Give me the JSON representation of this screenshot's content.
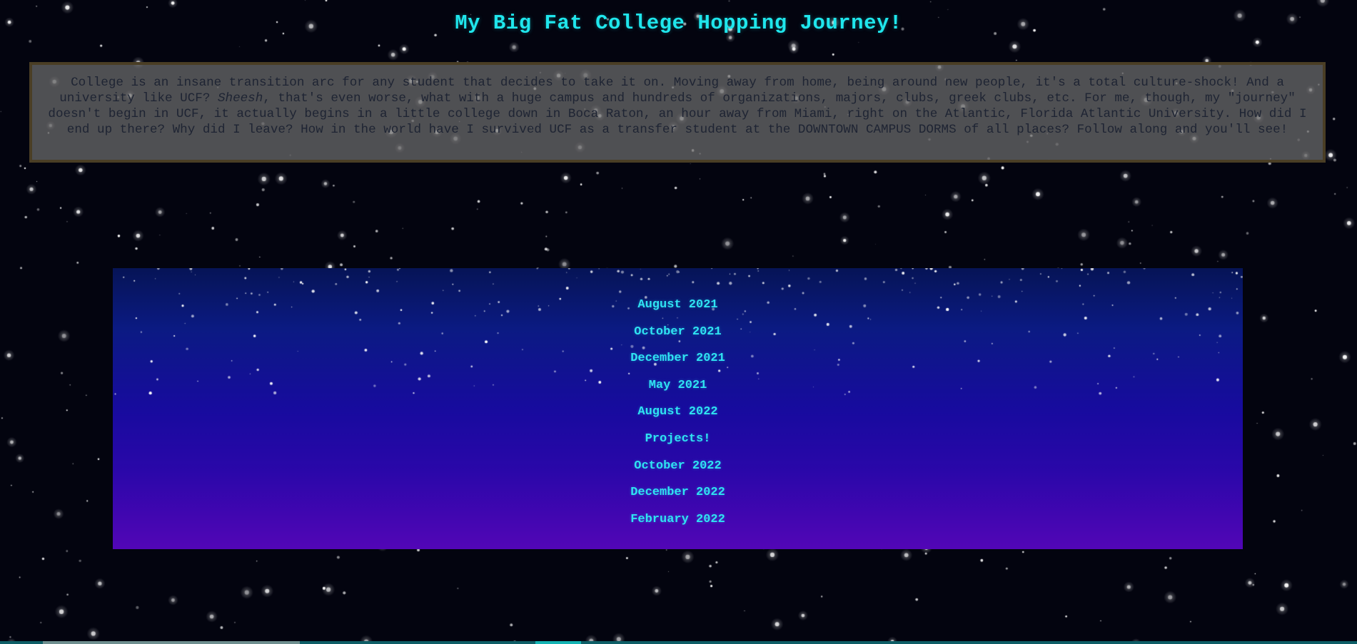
{
  "header": {
    "title": "My Big Fat College Hopping Journey!"
  },
  "intro": {
    "before_em": "College is an insane transition arc for any student that decides to take it on. Moving away from home, being around new people, it's a total culture-shock! And a university like UCF? ",
    "em": "Sheesh",
    "after_em": ", that's even worse, what with a huge campus and hundreds of organizations, majors, clubs, greek clubs, etc. For me, though, my \"journey\" doesn't begin in UCF, it actually begins in a little college down in Boca Raton, an hour away from Miami, right on the Atlantic, Florida Atlantic University. How did I end up there? Why did I leave? How in the world have I survived UCF as a transfer student at the DOWNTOWN CAMPUS DORMS of all places? Follow along and you'll see!"
  },
  "timeline": {
    "items": [
      {
        "label": "August 2021"
      },
      {
        "label": "October 2021"
      },
      {
        "label": "December 2021"
      },
      {
        "label": "May 2021"
      },
      {
        "label": "August 2022"
      },
      {
        "label": "Projects!"
      },
      {
        "label": "October 2022"
      },
      {
        "label": "December 2022"
      },
      {
        "label": "February 2022"
      }
    ]
  },
  "colors": {
    "title": "#1fe6ec",
    "link": "#2fe3f2",
    "page_background": "#03040f",
    "intro_background": "#6e6e6e",
    "intro_border": "#4a3e25",
    "panel_gradient_top": "#061456",
    "panel_gradient_bottom": "#5206b6"
  }
}
